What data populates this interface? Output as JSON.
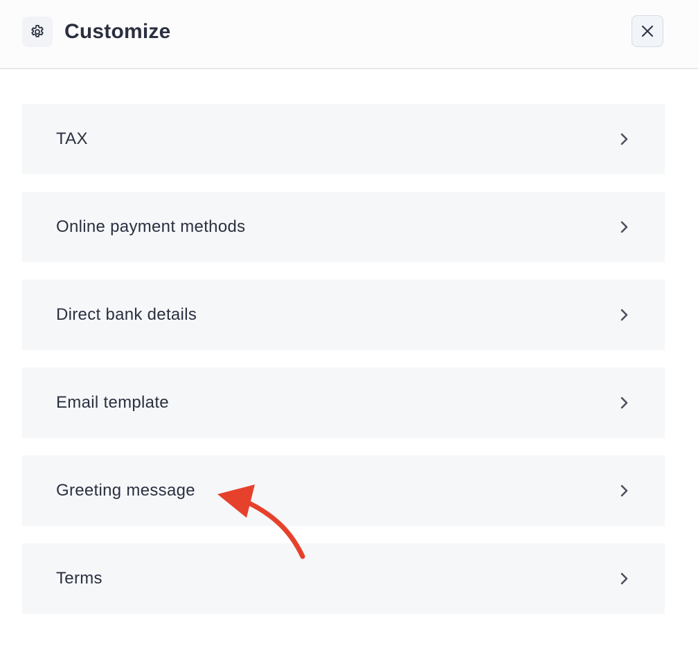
{
  "header": {
    "title": "Customize",
    "icon": "gear-icon",
    "close_icon": "close-icon"
  },
  "items": [
    {
      "label": "TAX"
    },
    {
      "label": "Online payment methods"
    },
    {
      "label": "Direct bank details"
    },
    {
      "label": "Email template"
    },
    {
      "label": "Greeting message"
    },
    {
      "label": "Terms"
    }
  ],
  "colors": {
    "text": "#2b3040",
    "item_bg": "#f6f7f9",
    "annotation_arrow": "#e6412b"
  }
}
